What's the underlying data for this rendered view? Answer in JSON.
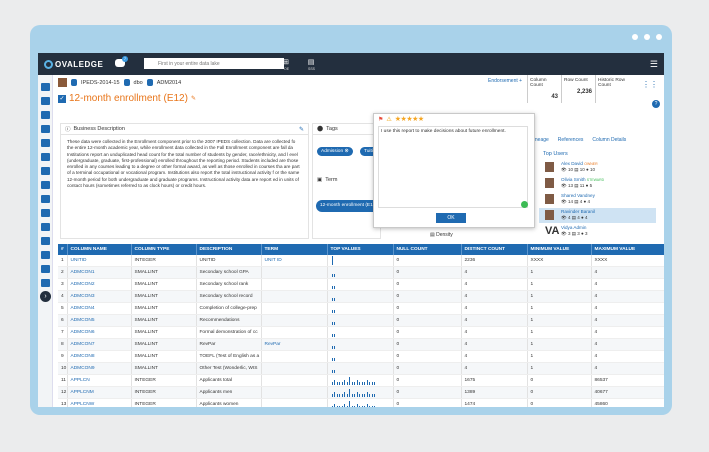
{
  "app": {
    "logo": "OVALEDGE",
    "chat_badge": "7",
    "search_placeholder": "First in your entire data lake",
    "toolbar": [
      {
        "label": ""
      },
      {
        "label": "OE"
      },
      {
        "label": "SSS"
      }
    ]
  },
  "breadcrumb": {
    "db": "IPEDS-2014-15",
    "schema": "dbo",
    "table": "ADM2014"
  },
  "page_title": "12-month enrollment (E12)",
  "endorsement_label": "Endorsement",
  "stats": [
    {
      "label": "Column Count",
      "value": "43"
    },
    {
      "label": "Row Count",
      "value": "2,236"
    },
    {
      "label": "Historic Row Count",
      "value": ""
    }
  ],
  "description": {
    "heading": "Business Description",
    "text": "These data were collected in the Enrollment component prior to the 2007 IPEDS collection. Data are collected fo the entire 12-month academic year, while enrollment data collected in the Fall Enrollment component are fall da Institutions report an unduplicated head count for the total number of students by gender, race/ethnicity, and l evel (undergraduate, graduate, first-professional) enrolled throughout the reporting period. Students included are those enrolled in any courses leading to a degree or other formal award, as well as those enrolled in courses tha are part of a terminal occupational or vocational program. Institutions also report the total instructional activity f or the same 12-month period for both undergraduate and graduate programs. Instructional activity data are report ed in units of contact hours (sometimes referred to as clock hours) or credit hours."
  },
  "tags_panel": {
    "heading": "Tags",
    "tags": [
      "Admission",
      "Tuiti"
    ],
    "term_heading": "Term",
    "term_value": "12-month enrollment (E12)"
  },
  "rating_modal": {
    "stars": "★★★★★",
    "comment": "I use this report to make decisions about future enrollment.",
    "ok_label": "OK"
  },
  "density_label": "Density",
  "nav_links": {
    "lineage": "Lineage",
    "references": "References",
    "column_details": "Column Details"
  },
  "top_users": {
    "heading": "Top Users",
    "users": [
      {
        "name": "Alex David",
        "tag": "OWNER",
        "views": "10",
        "c1": "10",
        "c2": "10"
      },
      {
        "name": "Olivia Smith",
        "tag": "STEWARD",
        "views": "13",
        "c1": "11",
        "c2": "5"
      },
      {
        "name": "Shared Vandney",
        "tag": "",
        "views": "14",
        "c1": "4",
        "c2": "4"
      },
      {
        "name": "Ravinder Baranil",
        "tag": "",
        "views": "4",
        "c1": "4",
        "c2": "4"
      },
      {
        "name": "Vidya Admin",
        "tag": "",
        "views": "3",
        "c1": "3",
        "c2": "3"
      }
    ]
  },
  "table": {
    "headers": [
      "#",
      "COLUMN NAME",
      "COLUMN TYPE",
      "DESCRIPTION",
      "TERM",
      "TOP VALUES",
      "NULL COUNT",
      "DISTINCT COUNT",
      "MINIMUM VALUE",
      "MAXIMUM VALUE"
    ],
    "rows": [
      [
        "1",
        "UNITID",
        "INTEGER",
        "UNITID",
        "UNIT ID",
        "",
        "0",
        "2236",
        "XXXX",
        "XXXX"
      ],
      [
        "2",
        "ADMCON1",
        "SMALLINT",
        "Secondary school GPA",
        "",
        "",
        "0",
        "4",
        "1",
        "4"
      ],
      [
        "3",
        "ADMCON2",
        "SMALLINT",
        "Secondary school rank",
        "",
        "",
        "0",
        "4",
        "1",
        "4"
      ],
      [
        "4",
        "ADMCON3",
        "SMALLINT",
        "Secondary school record",
        "",
        "",
        "0",
        "4",
        "1",
        "4"
      ],
      [
        "5",
        "ADMCON4",
        "SMALLINT",
        "Completion of college-prep",
        "",
        "",
        "0",
        "4",
        "1",
        "4"
      ],
      [
        "6",
        "ADMCON5",
        "SMALLINT",
        "Recommendations",
        "",
        "",
        "0",
        "4",
        "1",
        "4"
      ],
      [
        "7",
        "ADMCON6",
        "SMALLINT",
        "Formal demonstration of cc",
        "",
        "",
        "0",
        "4",
        "1",
        "4"
      ],
      [
        "8",
        "ADMCON7",
        "SMALLINT",
        "RevPar",
        "RevPar",
        "",
        "0",
        "4",
        "1",
        "4"
      ],
      [
        "9",
        "ADMCON8",
        "SMALLINT",
        "TOEFL (Test of English as a",
        "",
        "",
        "0",
        "4",
        "1",
        "4"
      ],
      [
        "10",
        "ADMCON9",
        "SMALLINT",
        "Other Test (Wonderlic, WIS",
        "",
        "",
        "0",
        "4",
        "1",
        "4"
      ],
      [
        "11",
        "APPLCN",
        "INTEGER",
        "Applicants total",
        "",
        "",
        "0",
        "1675",
        "0",
        "86537"
      ],
      [
        "12",
        "APPLCNM",
        "INTEGER",
        "Applicants men",
        "",
        "",
        "0",
        "1389",
        "0",
        "40677"
      ],
      [
        "13",
        "APPLCNW",
        "INTEGER",
        "Applicants women",
        "",
        "",
        "0",
        "1474",
        "0",
        "45860"
      ],
      [
        "14",
        "ADMSSN",
        "INTEGER",
        "Admissions total",
        "",
        "",
        "0",
        "1549",
        "0",
        "35098"
      ]
    ]
  },
  "colors": {
    "brand_blue": "#1f6ab1",
    "topbar": "#232f3e",
    "title_orange": "#e8751a"
  }
}
